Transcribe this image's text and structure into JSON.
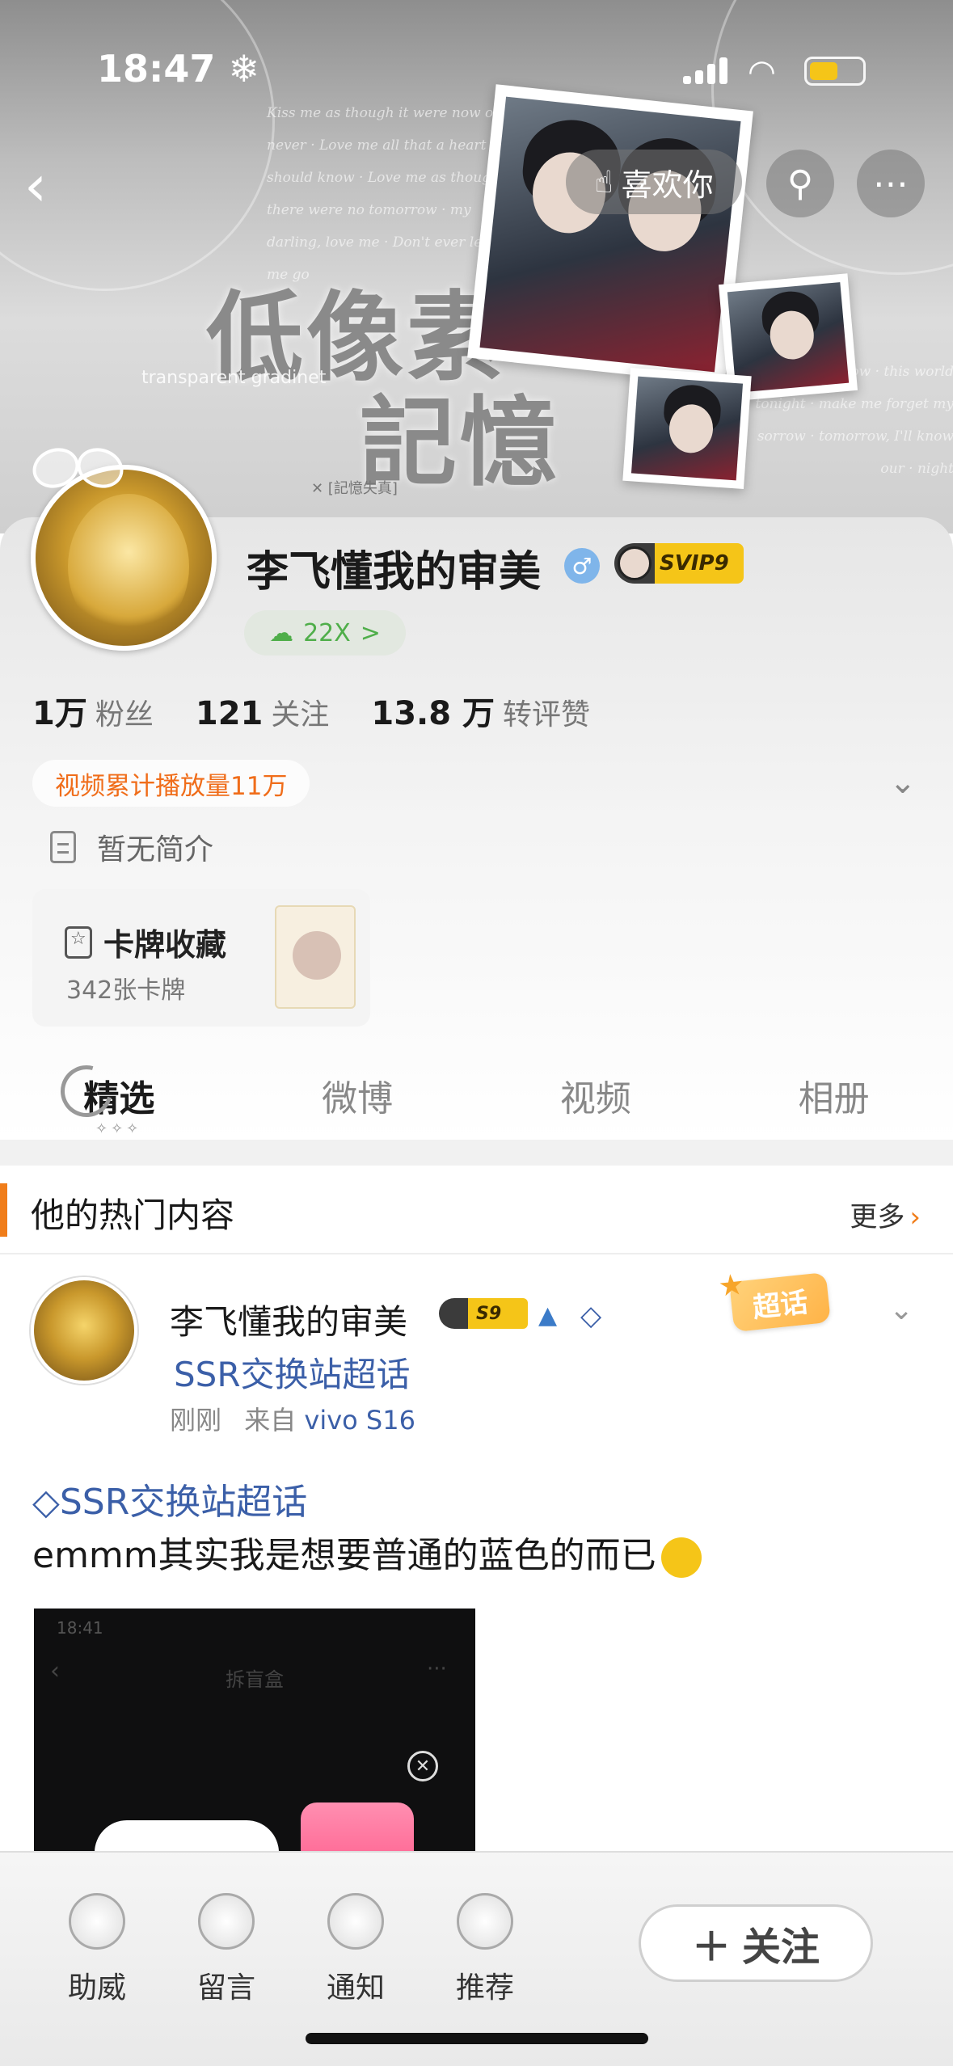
{
  "status_bar": {
    "time": "18:47 ❄"
  },
  "cover": {
    "title_line1": "低像素",
    "title_line2": "記憶",
    "subtitle_en": "transparent gradinet",
    "memory_label": "✕ [記憶失真]",
    "script_left": "Kiss me as though it were now or never · Love me all that a heart should know · Love me as though there were no tomorrow · my darling, love me · Don't ever let me go",
    "script_right": "no tomorrow · this world tonight · make me forget my sorrow · tomorrow, I'll know our · night"
  },
  "nav": {
    "like_label": "喜欢你"
  },
  "profile": {
    "username": "李飞懂我的审美",
    "gender_icon": "♂",
    "svip_label": "SVIP9",
    "level_label": "22X",
    "level_chevron": ">",
    "stats": [
      {
        "num": "1万",
        "label": "粉丝"
      },
      {
        "num": "121",
        "label": "关注"
      },
      {
        "num": "13.8 万",
        "label": "转评赞"
      }
    ],
    "video_stat": "视频累计播放量11万",
    "bio": "暂无简介",
    "cards": {
      "title": "卡牌收藏",
      "count": "342张卡牌"
    }
  },
  "tabs": [
    {
      "label": "精选"
    },
    {
      "label": "微博"
    },
    {
      "label": "视频"
    },
    {
      "label": "相册"
    }
  ],
  "hot": {
    "title": "他的热门内容",
    "more": "更多",
    "post": {
      "author": "李飞懂我的审美",
      "badge": "S9",
      "topic": "SSR交换站超话",
      "time": "刚刚",
      "source_prefix": "来自",
      "source": "vivo S16",
      "chaohua_label": "超话",
      "hashtag": "SSR交换站超话",
      "text": "emmm其实我是想要普通的蓝色的而已",
      "screenshot": {
        "time": "18:41",
        "title": "拆盲盒"
      }
    }
  },
  "bottom_bar": {
    "items": [
      {
        "label": "助威"
      },
      {
        "label": "留言"
      },
      {
        "label": "通知"
      },
      {
        "label": "推荐"
      }
    ],
    "follow_label": "关注"
  }
}
